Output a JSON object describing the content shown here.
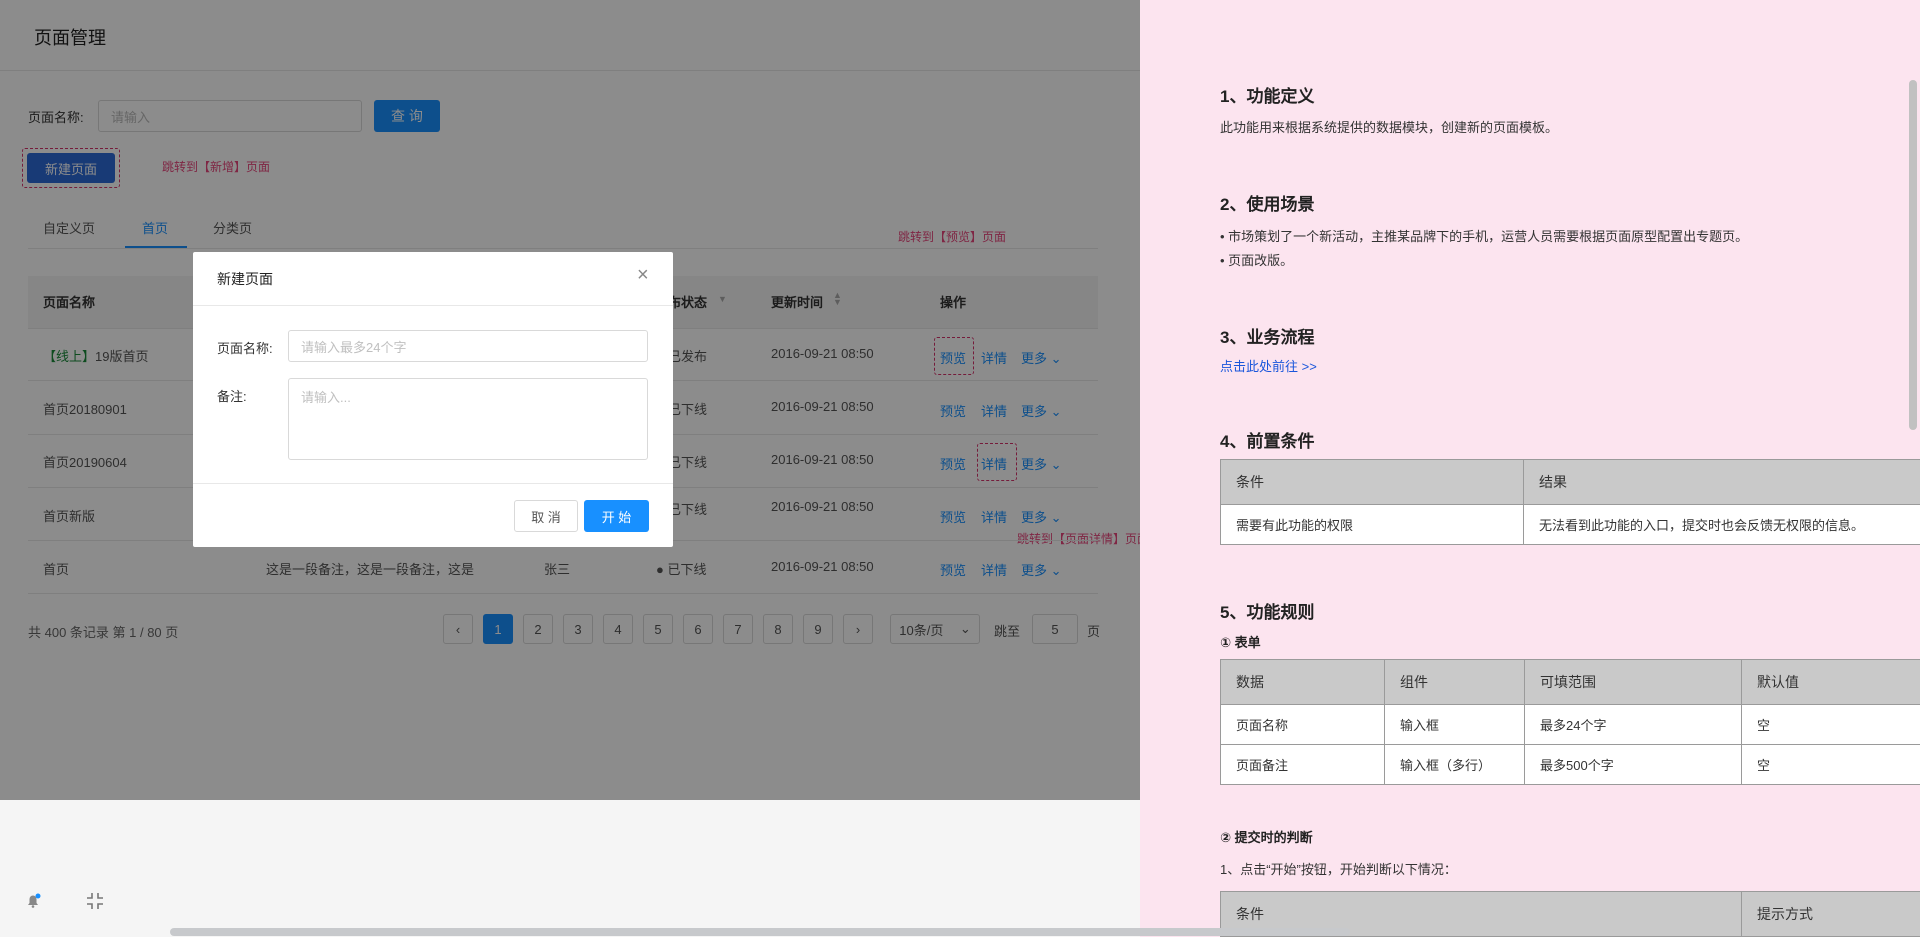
{
  "header": {
    "title": "页面管理"
  },
  "search": {
    "label": "页面名称:",
    "placeholder": "请输入",
    "query_button": "查 询"
  },
  "new_page_button": "新建页面",
  "annotations": {
    "new": "跳转到【新增】页面",
    "preview": "跳转到【预览】页面",
    "detail": "跳转到【页面详情】页面"
  },
  "tabs": [
    "自定义页",
    "首页",
    "分类页"
  ],
  "active_tab": "首页",
  "table": {
    "headers": {
      "name": "页面名称",
      "status": "布状态",
      "time": "更新时间",
      "ops": "操作"
    },
    "rows": [
      {
        "tag": "【线上】",
        "name": "19版首页",
        "note": "",
        "owner": "",
        "status": "已发布",
        "time": "2016-09-21  08:50"
      },
      {
        "tag": "",
        "name": "首页20180901",
        "note": "",
        "owner": "",
        "status": "已下线",
        "time": "2016-09-21  08:50"
      },
      {
        "tag": "",
        "name": "首页20190604",
        "note": "",
        "owner": "",
        "status": "已下线",
        "time": "2016-09-21  08:50"
      },
      {
        "tag": "",
        "name": "首页新版",
        "note": "",
        "owner": "",
        "status": "已下线",
        "time": "2016-09-21  08:50"
      },
      {
        "tag": "",
        "name": "首页",
        "note": "这是一段备注，这是一段备注，这是",
        "owner": "张三",
        "status": "● 已下线",
        "time": "2016-09-21  08:50"
      }
    ],
    "actions": {
      "preview": "预览",
      "detail": "详情",
      "more": "更多"
    }
  },
  "pagination": {
    "summary": "共 400 条记录 第 1 / 80 页",
    "pages": [
      "1",
      "2",
      "3",
      "4",
      "5",
      "6",
      "7",
      "8",
      "9"
    ],
    "current": "1",
    "page_size": "10条/页",
    "jump_label": "跳至",
    "jump_value": "5",
    "page_unit": "页"
  },
  "modal": {
    "title": "新建页面",
    "name_label": "页面名称:",
    "name_placeholder": "请输入最多24个字",
    "note_label": "备注:",
    "note_placeholder": "请输入...",
    "cancel": "取 消",
    "start": "开 始"
  },
  "doc": {
    "s1_title": "1、功能定义",
    "s1_text": "此功能用来根据系统提供的数据模块，创建新的页面模板。",
    "s2_title": "2、使用场景",
    "s2_items": [
      "• 市场策划了一个新活动，主推某品牌下的手机，运营人员需要根据页面原型配置出专题页。",
      "• 页面改版。"
    ],
    "s3_title": "3、业务流程",
    "s3_link": "点击此处前往 >>",
    "s4_title": "4、前置条件",
    "t1_headers": [
      "条件",
      "结果"
    ],
    "t1_rows": [
      [
        "需要有此功能的权限",
        "无法看到此功能的入口，提交时也会反馈无权限的信息。"
      ]
    ],
    "s5_title": "5、功能规则",
    "s5_sub1": "① 表单",
    "t2_headers": [
      "数据",
      "组件",
      "可填范围",
      "默认值"
    ],
    "t2_rows": [
      [
        "页面名称",
        "输入框",
        "最多24个字",
        "空"
      ],
      [
        "页面备注",
        "输入框（多行）",
        "最多500个字",
        "空"
      ]
    ],
    "s5_sub2": "② 提交时的判断",
    "s5_text2": "1、点击“开始”按钮，开始判断以下情况：",
    "t3_headers": [
      "条件",
      "提示方式"
    ]
  },
  "colors": {
    "primary": "#1890ff",
    "annotation": "#e8467c",
    "doc_bg": "#fce4ef",
    "online_tag": "#1a8a3a"
  },
  "icons": [
    "close-icon",
    "chevron-down-icon",
    "sort-icon",
    "filter-icon",
    "bell-icon",
    "collapse-icon"
  ]
}
